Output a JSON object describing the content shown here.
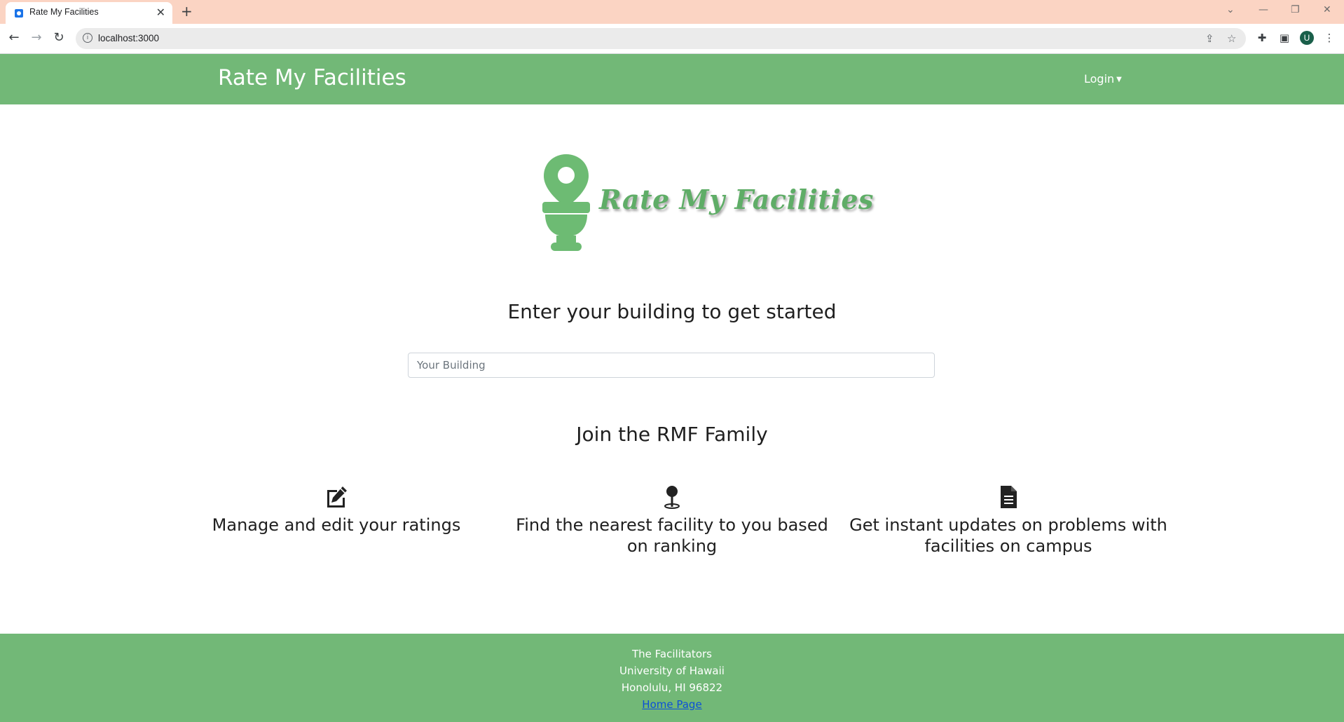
{
  "browser": {
    "tab_title": "Rate My Facilities",
    "url": "localhost:3000",
    "profile_initial": "U",
    "icons": [
      "favicon-icon",
      "close-icon",
      "plus-icon",
      "back-icon",
      "forward-icon",
      "reload-icon",
      "info-icon",
      "share-icon",
      "star-icon",
      "extensions-icon",
      "side-panel-icon",
      "menu-icon"
    ]
  },
  "navbar": {
    "brand": "Rate My Facilities",
    "login_label": "Login",
    "background": "#72b877"
  },
  "hero": {
    "logo_text": "Rate My Facilities",
    "logo_color": "#5fad67",
    "headline": "Enter your building to get started",
    "search_placeholder": "Your Building"
  },
  "join": {
    "title": "Join the RMF Family",
    "features": [
      {
        "icon": "edit-icon",
        "label": "Manage and edit your ratings"
      },
      {
        "icon": "map-pin-icon",
        "label": "Find the nearest facility to you based on ranking"
      },
      {
        "icon": "document-icon",
        "label": "Get instant updates on problems with facilities on campus"
      }
    ]
  },
  "footer": {
    "line1": "The Facilitators",
    "line2": "University of Hawaii",
    "line3": "Honolulu, HI 96822",
    "link_label": "Home Page"
  }
}
